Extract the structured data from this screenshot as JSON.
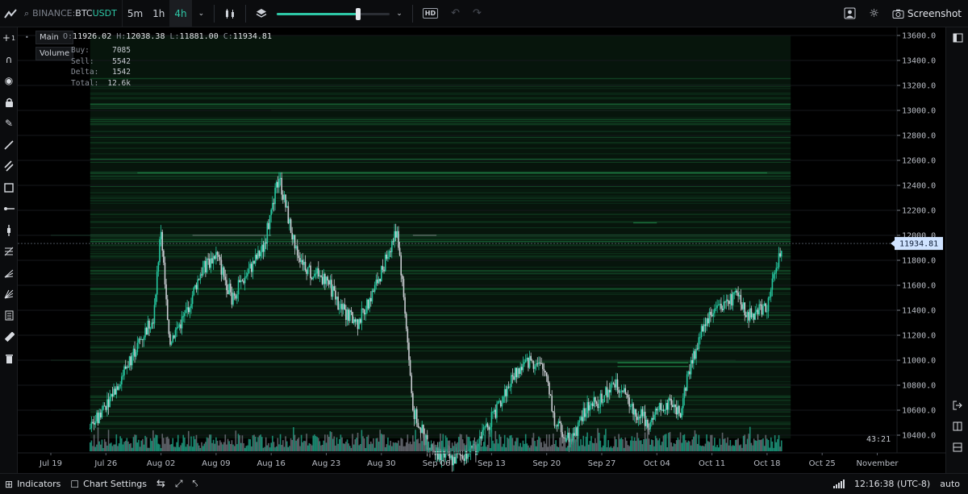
{
  "topbar": {
    "exchange": "BINANCE:",
    "base": "BTC",
    "quote": "USDT",
    "timeframes": [
      {
        "label": "5m",
        "active": false
      },
      {
        "label": "1h",
        "active": false
      },
      {
        "label": "4h",
        "active": true
      }
    ],
    "slider_level": 0.72,
    "hd_label": "HD",
    "screenshot_label": "Screenshot"
  },
  "legend": {
    "main_label": "Main",
    "volume_label": "Volume",
    "ohlc": {
      "o_key": "O:",
      "o": "11926.02",
      "h_key": "H:",
      "h": "12038.38",
      "l_key": "L:",
      "l": "11881.00",
      "c_key": "C:",
      "c": "11934.81"
    },
    "stats": [
      {
        "label": "Buy:",
        "value": "7085"
      },
      {
        "label": "Sell:",
        "value": "5542"
      },
      {
        "label": "Delta:",
        "value": "1542"
      },
      {
        "label": "Total:",
        "value": "12.6k"
      }
    ]
  },
  "countdown": "43:21",
  "bottombar": {
    "indicators_label": "Indicators",
    "chart_settings_label": "Chart Settings",
    "clock": "12:16:38 (UTC-8)",
    "scale_mode": "auto"
  },
  "colors": {
    "up": "#26c6a0",
    "down": "#c9ccd2",
    "heatmap": "#2ec76a",
    "price_tag_bg": "#cfe3ff",
    "price_tag_text": "#0b1a33"
  },
  "chart_data": {
    "type": "candlestick-heatmap",
    "symbol": "BINANCE:BTCUSDT",
    "interval": "4h",
    "last_price": 11934.81,
    "last_price_label": "11934.81",
    "y_ticks": [
      "13600.0",
      "13400.0",
      "13200.0",
      "13000.0",
      "12800.0",
      "12600.0",
      "12400.0",
      "12200.0",
      "12000.0",
      "11800.0",
      "11600.0",
      "11400.0",
      "11200.0",
      "11000.0",
      "10800.0",
      "10600.0",
      "10400.0"
    ],
    "y_tick_values": [
      13600,
      13400,
      13200,
      13000,
      12800,
      12600,
      12400,
      12200,
      12000,
      11800,
      11600,
      11400,
      11200,
      11000,
      10800,
      10600,
      10400
    ],
    "x_ticks": [
      "Jul 19",
      "Jul 26",
      "Aug 02",
      "Aug 09",
      "Aug 16",
      "Aug 23",
      "Aug 30",
      "Sep 06",
      "Sep 13",
      "Sep 20",
      "Sep 27",
      "Oct 04",
      "Oct 11",
      "Oct 18",
      "Oct 25",
      "November"
    ],
    "price_path": [
      {
        "date": "Jul 24",
        "price": 10450
      },
      {
        "date": "Jul 27",
        "price": 10750
      },
      {
        "date": "Jul 29",
        "price": 11000
      },
      {
        "date": "Aug 01",
        "price": 11350
      },
      {
        "date": "Aug 02",
        "price": 12050
      },
      {
        "date": "Aug 03",
        "price": 11150
      },
      {
        "date": "Aug 05",
        "price": 11350
      },
      {
        "date": "Aug 07",
        "price": 11700
      },
      {
        "date": "Aug 09",
        "price": 11850
      },
      {
        "date": "Aug 11",
        "price": 11500
      },
      {
        "date": "Aug 13",
        "price": 11700
      },
      {
        "date": "Aug 15",
        "price": 11900
      },
      {
        "date": "Aug 17",
        "price": 12470
      },
      {
        "date": "Aug 19",
        "price": 11900
      },
      {
        "date": "Aug 21",
        "price": 11700
      },
      {
        "date": "Aug 23",
        "price": 11650
      },
      {
        "date": "Aug 25",
        "price": 11400
      },
      {
        "date": "Aug 27",
        "price": 11300
      },
      {
        "date": "Aug 29",
        "price": 11550
      },
      {
        "date": "Sep 01",
        "price": 12050
      },
      {
        "date": "Sep 02",
        "price": 11400
      },
      {
        "date": "Sep 03",
        "price": 10600
      },
      {
        "date": "Sep 05",
        "price": 10300
      },
      {
        "date": "Sep 08",
        "price": 10200
      },
      {
        "date": "Sep 11",
        "price": 10300
      },
      {
        "date": "Sep 14",
        "price": 10650
      },
      {
        "date": "Sep 16",
        "price": 10900
      },
      {
        "date": "Sep 18",
        "price": 11000
      },
      {
        "date": "Sep 20",
        "price": 10900
      },
      {
        "date": "Sep 21",
        "price": 10500
      },
      {
        "date": "Sep 23",
        "price": 10350
      },
      {
        "date": "Sep 25",
        "price": 10600
      },
      {
        "date": "Sep 27",
        "price": 10700
      },
      {
        "date": "Sep 29",
        "price": 10800
      },
      {
        "date": "Oct 01",
        "price": 10600
      },
      {
        "date": "Oct 03",
        "price": 10500
      },
      {
        "date": "Oct 05",
        "price": 10650
      },
      {
        "date": "Oct 07",
        "price": 10600
      },
      {
        "date": "Oct 08",
        "price": 10900
      },
      {
        "date": "Oct 10",
        "price": 11300
      },
      {
        "date": "Oct 12",
        "price": 11450
      },
      {
        "date": "Oct 14",
        "price": 11500
      },
      {
        "date": "Oct 16",
        "price": 11350
      },
      {
        "date": "Oct 18",
        "price": 11450
      },
      {
        "date": "Oct 20",
        "price": 11934.81
      }
    ]
  }
}
